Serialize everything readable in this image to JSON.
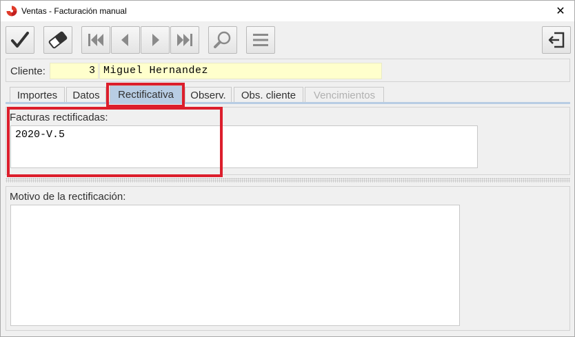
{
  "window": {
    "title": "Ventas - Facturación manual",
    "close_glyph": "✕"
  },
  "toolbar": {
    "buttons": [
      {
        "name": "accept-button",
        "icon": "check-icon"
      },
      {
        "name": "clear-button",
        "icon": "eraser-icon"
      },
      {
        "name": "first-record-button",
        "icon": "skip-first-icon"
      },
      {
        "name": "previous-record-button",
        "icon": "triangle-left-icon"
      },
      {
        "name": "next-record-button",
        "icon": "triangle-right-icon"
      },
      {
        "name": "last-record-button",
        "icon": "skip-last-icon"
      },
      {
        "name": "search-button",
        "icon": "magnifier-icon"
      },
      {
        "name": "menu-button",
        "icon": "hamburger-menu-icon"
      },
      {
        "name": "exit-button",
        "icon": "exit-door-icon"
      }
    ]
  },
  "client": {
    "label": "Cliente:",
    "number": "3",
    "name": "Miguel Hernandez"
  },
  "tabs": [
    {
      "label": "Importes",
      "state": "normal"
    },
    {
      "label": "Datos",
      "state": "normal"
    },
    {
      "label": "Rectificativa",
      "state": "active"
    },
    {
      "label": "Observ.",
      "state": "normal"
    },
    {
      "label": "Obs. cliente",
      "state": "normal"
    },
    {
      "label": "Vencimientos",
      "state": "disabled"
    }
  ],
  "rectified": {
    "label": "Facturas rectificadas:",
    "value": "2020-V.5"
  },
  "reason": {
    "label": "Motivo de la rectificación:",
    "value": ""
  },
  "colors": {
    "field_background": "#ffffcc",
    "active_tab": "#b8cde4",
    "highlight": "#dc1e2c"
  }
}
